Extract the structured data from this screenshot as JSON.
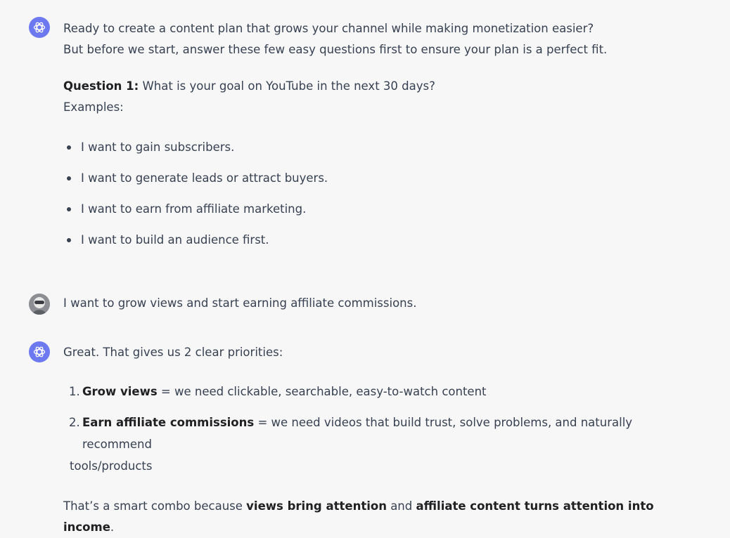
{
  "messages": {
    "first": {
      "line1": "Ready to create a content plan that grows your channel while making monetization easier?",
      "line2": "But before we start, answer these few easy questions first to ensure your plan is a perfect fit.",
      "question_label": "Question 1:",
      "question_text": " What is your goal on YouTube in the next 30 days?",
      "examples_label": "Examples:",
      "examples": [
        "I want to gain subscribers.",
        "I want to generate leads or attract buyers.",
        "I want to earn from affiliate marketing.",
        "I want to build an audience first."
      ]
    },
    "user": {
      "text": "I want to grow views and start earning affiliate commissions."
    },
    "second": {
      "intro": "Great. That gives us 2 clear priorities:",
      "items": [
        {
          "num": "1.",
          "bold": "Grow views",
          "rest": " = we need clickable, searchable, easy-to-watch content"
        },
        {
          "num": "2.",
          "bold": "Earn affiliate commissions",
          "rest": " = we need videos that build trust, solve problems, and naturally recommend",
          "rest2": "tools/products"
        }
      ],
      "closing_1": "That’s a smart combo because ",
      "closing_bold1": "views bring attention",
      "closing_2": " and ",
      "closing_bold2": "affiliate content turns attention into income",
      "closing_3": "."
    }
  },
  "icons": {
    "assistant": "openai-logo-icon",
    "user": "user-avatar-icon"
  },
  "colors": {
    "background": "#f7f7f8",
    "assistant_avatar": "#6d79f0",
    "text": "#374151",
    "bold_text": "#202123"
  }
}
